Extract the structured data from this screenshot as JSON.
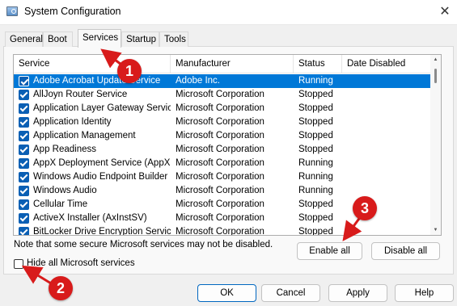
{
  "window": {
    "title": "System Configuration",
    "close_glyph": "✕",
    "app_icon": "msconfig-icon"
  },
  "tabs": [
    {
      "label": "General",
      "active": false
    },
    {
      "label": "Boot",
      "active": false
    },
    {
      "label": "Services",
      "active": true
    },
    {
      "label": "Startup",
      "active": false
    },
    {
      "label": "Tools",
      "active": false
    }
  ],
  "services_table": {
    "columns": [
      "Service",
      "Manufacturer",
      "Status",
      "Date Disabled"
    ],
    "rows": [
      {
        "service": "Adobe Acrobat Update Service",
        "manufacturer": "Adobe Inc.",
        "status": "Running",
        "date_disabled": "",
        "checked": true,
        "selected": true
      },
      {
        "service": "AllJoyn Router Service",
        "manufacturer": "Microsoft Corporation",
        "status": "Stopped",
        "date_disabled": "",
        "checked": true
      },
      {
        "service": "Application Layer Gateway Service",
        "manufacturer": "Microsoft Corporation",
        "status": "Stopped",
        "date_disabled": "",
        "checked": true
      },
      {
        "service": "Application Identity",
        "manufacturer": "Microsoft Corporation",
        "status": "Stopped",
        "date_disabled": "",
        "checked": true
      },
      {
        "service": "Application Management",
        "manufacturer": "Microsoft Corporation",
        "status": "Stopped",
        "date_disabled": "",
        "checked": true
      },
      {
        "service": "App Readiness",
        "manufacturer": "Microsoft Corporation",
        "status": "Stopped",
        "date_disabled": "",
        "checked": true
      },
      {
        "service": "AppX Deployment Service (AppX...",
        "manufacturer": "Microsoft Corporation",
        "status": "Running",
        "date_disabled": "",
        "checked": true
      },
      {
        "service": "Windows Audio Endpoint Builder",
        "manufacturer": "Microsoft Corporation",
        "status": "Running",
        "date_disabled": "",
        "checked": true
      },
      {
        "service": "Windows Audio",
        "manufacturer": "Microsoft Corporation",
        "status": "Running",
        "date_disabled": "",
        "checked": true
      },
      {
        "service": "Cellular Time",
        "manufacturer": "Microsoft Corporation",
        "status": "Stopped",
        "date_disabled": "",
        "checked": true
      },
      {
        "service": "ActiveX Installer (AxInstSV)",
        "manufacturer": "Microsoft Corporation",
        "status": "Stopped",
        "date_disabled": "",
        "checked": true
      },
      {
        "service": "BitLocker Drive Encryption Service",
        "manufacturer": "Microsoft Corporation",
        "status": "Stopped",
        "date_disabled": "",
        "checked": true
      }
    ]
  },
  "note": "Note that some secure Microsoft services may not be disabled.",
  "enable_all_label": "Enable all",
  "disable_all_label": "Disable all",
  "hide_ms_label": "Hide all Microsoft services",
  "hide_ms_checked": false,
  "footer_buttons": {
    "ok": "OK",
    "cancel": "Cancel",
    "apply": "Apply",
    "help": "Help"
  },
  "annotations": [
    {
      "number": "1",
      "color": "#d81b1b"
    },
    {
      "number": "2",
      "color": "#d81b1b"
    },
    {
      "number": "3",
      "color": "#d81b1b"
    }
  ],
  "colors": {
    "selection": "#0078d7",
    "checkbox": "#0a5fb4",
    "badge": "#d81b1b"
  }
}
